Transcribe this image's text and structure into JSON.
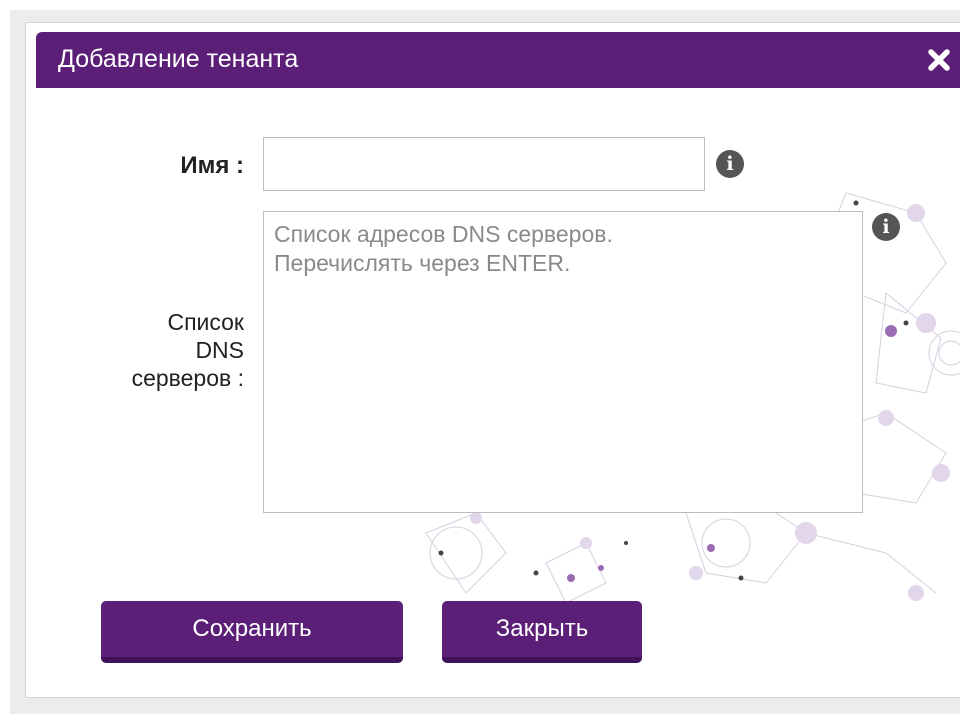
{
  "dialog": {
    "title": "Добавление тенанта",
    "close_icon": "close-icon",
    "accent_color": "#5b1f78"
  },
  "form": {
    "name": {
      "label": "Имя :",
      "value": "",
      "info_icon": "info-icon"
    },
    "dns": {
      "label_lines": [
        "Список",
        "DNS",
        "серверов :"
      ],
      "placeholder": "Список адресов DNS серверов.\nПеречислять через ENTER.",
      "value": "",
      "info_icon": "info-icon"
    }
  },
  "buttons": {
    "save_label": "Сохранить",
    "close_label": "Закрыть"
  }
}
